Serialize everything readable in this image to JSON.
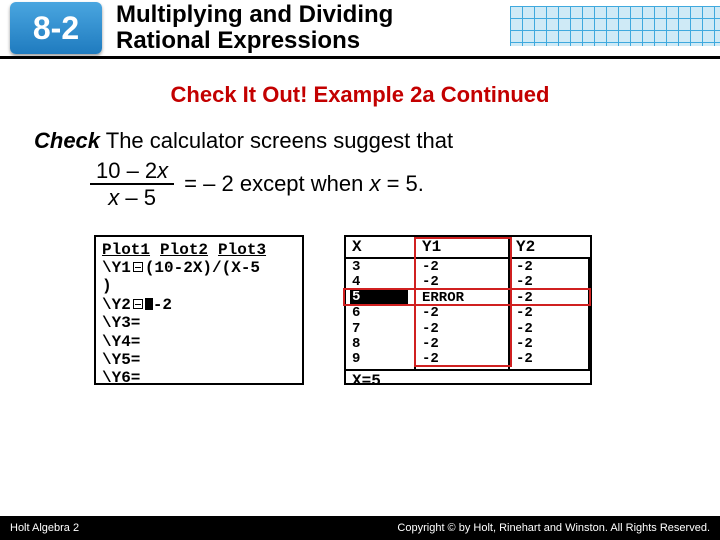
{
  "header": {
    "lesson_number": "8-2",
    "chapter_title_line1": "Multiplying and Dividing",
    "chapter_title_line2": "Rational Expressions"
  },
  "subhead": "Check It Out! Example 2a Continued",
  "body": {
    "check_label": "Check",
    "sentence_after_check": " The calculator screens suggest that",
    "fraction": {
      "numerator_a": "10 – 2",
      "numerator_var": "x",
      "denominator_var": "x",
      "denominator_b": " – 5"
    },
    "eq_rest_a": " = – 2 except when ",
    "eq_var": "x",
    "eq_rest_b": " = 5."
  },
  "calc_left": {
    "plots": [
      "Plot1",
      "Plot2",
      "Plot3"
    ],
    "line1_pre": "\\Y1",
    "line1_post": "(10-2X)/(X-5",
    "line2": ")",
    "line3_pre": "\\Y2",
    "line3_post": "-2",
    "blank_lines": [
      "\\Y3=",
      "\\Y4=",
      "\\Y5=",
      "\\Y6="
    ]
  },
  "calc_right": {
    "headers": [
      "X",
      "Y1",
      "Y2"
    ],
    "x_vals": [
      "3",
      "4",
      "5",
      "6",
      "7",
      "8",
      "9"
    ],
    "y1_vals": [
      "-2",
      "-2",
      "ERROR",
      "-2",
      "-2",
      "-2",
      "-2"
    ],
    "y2_vals": [
      "-2",
      "-2",
      "-2",
      "-2",
      "-2",
      "-2",
      "-2"
    ],
    "highlight_x": "5",
    "footer": "X=5"
  },
  "footer": {
    "left": "Holt Algebra 2",
    "right": "Copyright © by Holt, Rinehart and Winston. All Rights Reserved."
  }
}
